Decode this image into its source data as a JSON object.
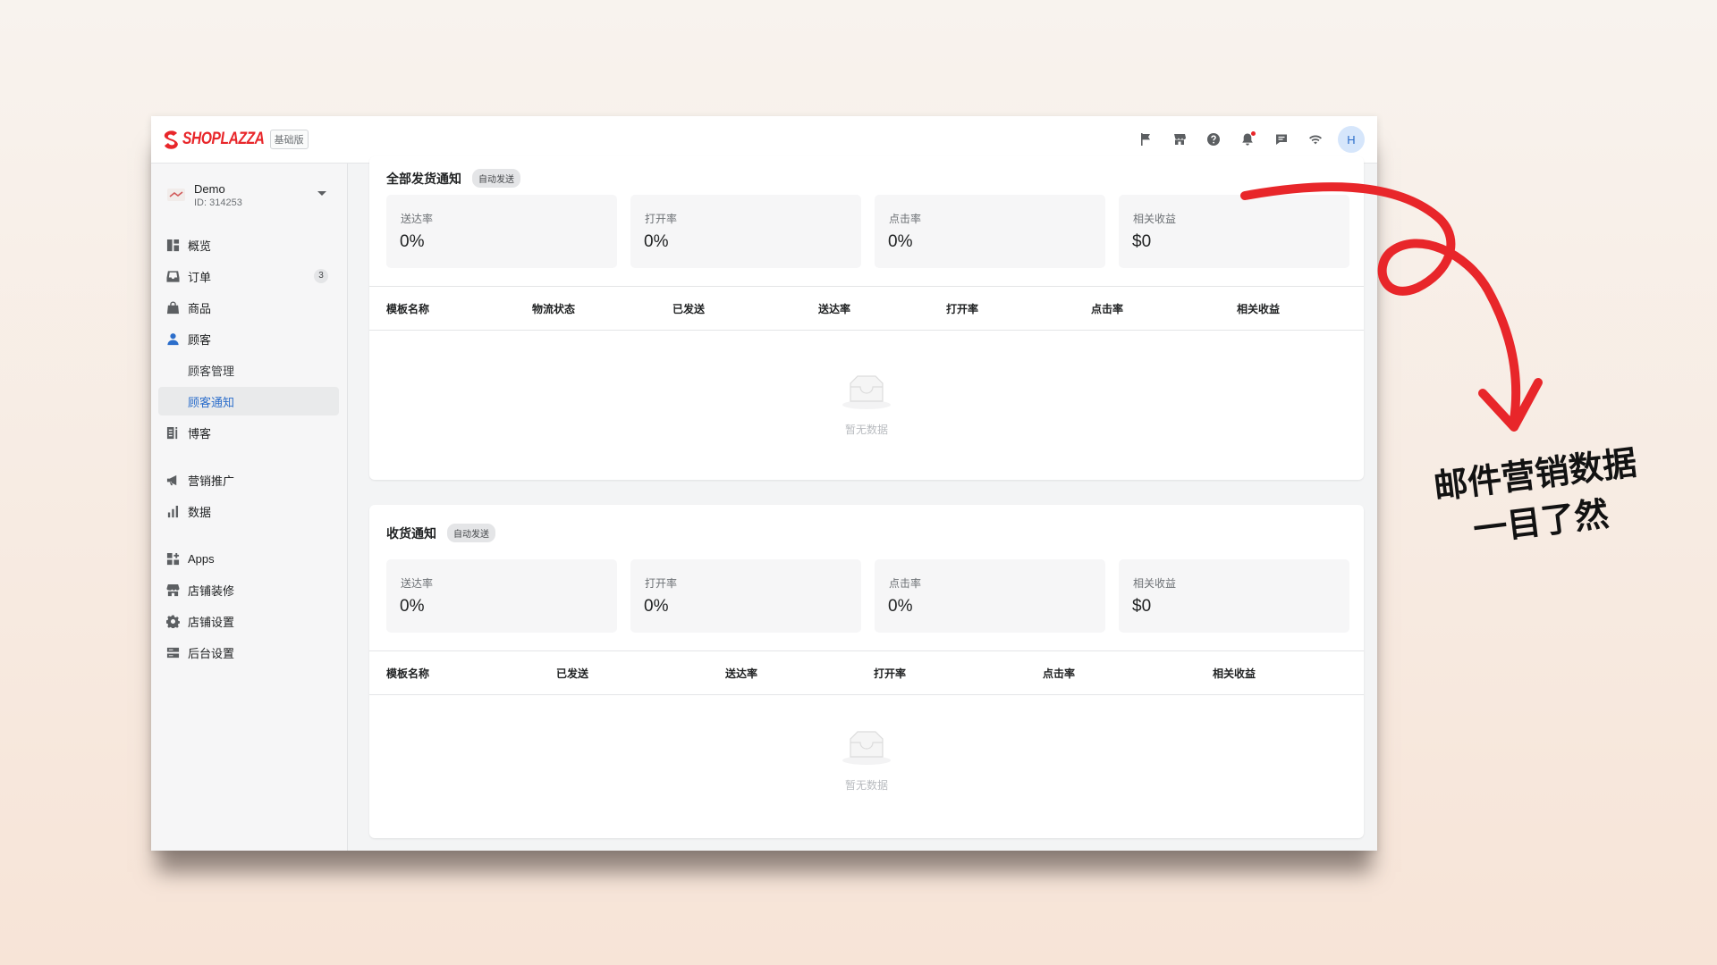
{
  "topbar": {
    "brand": "SHOPLAZZA",
    "plan_badge": "基础版",
    "icons": [
      "flag-icon",
      "store-icon",
      "help-icon",
      "bell-icon",
      "chat-icon",
      "wifi-icon"
    ],
    "avatar_initial": "H"
  },
  "store": {
    "name": "Demo",
    "id": "ID: 314253"
  },
  "sidebar": {
    "items": [
      {
        "label": "概览",
        "icon": "overview-icon"
      },
      {
        "label": "订单",
        "icon": "inbox-icon",
        "count": "3"
      },
      {
        "label": "商品",
        "icon": "bag-icon"
      },
      {
        "label": "顾客",
        "icon": "person-icon"
      },
      {
        "label": "顾客管理"
      },
      {
        "label": "顾客通知",
        "active": true
      },
      {
        "label": "博客",
        "icon": "blog-icon"
      },
      {
        "label": "营销推广",
        "icon": "megaphone-icon"
      },
      {
        "label": "数据",
        "icon": "chart-icon"
      },
      {
        "label": "Apps",
        "icon": "apps-icon"
      },
      {
        "label": "店铺装修",
        "icon": "store-icon"
      },
      {
        "label": "店铺设置",
        "icon": "gear-icon"
      },
      {
        "label": "后台设置",
        "icon": "server-icon"
      }
    ]
  },
  "shipping_card": {
    "title": "全部发货通知",
    "tag": "自动发送",
    "metrics": [
      {
        "label": "送达率",
        "value": "0%"
      },
      {
        "label": "打开率",
        "value": "0%"
      },
      {
        "label": "点击率",
        "value": "0%"
      },
      {
        "label": "相关收益",
        "value": "$0"
      }
    ],
    "columns": [
      "模板名称",
      "物流状态",
      "已发送",
      "送达率",
      "打开率",
      "点击率",
      "相关收益"
    ],
    "empty_text": "暂无数据"
  },
  "receipt_card": {
    "title": "收货通知",
    "tag": "自动发送",
    "metrics": [
      {
        "label": "送达率",
        "value": "0%"
      },
      {
        "label": "打开率",
        "value": "0%"
      },
      {
        "label": "点击率",
        "value": "0%"
      },
      {
        "label": "相关收益",
        "value": "$0"
      }
    ],
    "columns": [
      "模板名称",
      "已发送",
      "送达率",
      "打开率",
      "点击率",
      "相关收益"
    ],
    "empty_text": "暂无数据"
  },
  "annotation": {
    "line1": "邮件营销数据",
    "line2": "一目了然"
  },
  "colors": {
    "brand_red": "#e8262a",
    "active_blue": "#2c6ecb",
    "arrow_red": "#e8262a"
  }
}
